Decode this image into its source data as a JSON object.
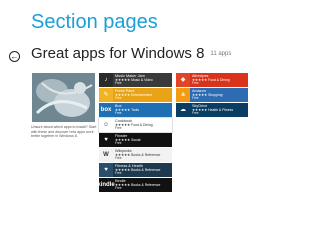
{
  "page_title": "Section pages",
  "collection": {
    "title": "Great apps for Windows 8",
    "count": "11 apps",
    "description": "Unsure about which apps to install? Start with these and discover how apps work better together in Windows 8."
  },
  "apps": [
    {
      "name": "Music Maker Jam",
      "rating": "★★★★★",
      "category": "Music & Video",
      "price": "Free",
      "bg": "#3a3a3a",
      "icon_bg": "#2b2b2b",
      "icon": "♪"
    },
    {
      "name": "Fresh Paint",
      "rating": "★★★★★",
      "category": "Entertainment",
      "price": "Free",
      "bg": "#e8a317",
      "icon_bg": "#f0b323",
      "icon": "✎"
    },
    {
      "name": "Box",
      "rating": "★★★★★",
      "category": "Tools",
      "price": "Free",
      "bg": "#1f6fb5",
      "icon_bg": "#1f6fb5",
      "icon": "box"
    },
    {
      "name": "Cookbook",
      "rating": "★★★★★",
      "category": "Food & Dining",
      "price": "Free",
      "bg": "#ffffff",
      "icon_bg": "#ffffff",
      "icon": "☺",
      "text_color": "#333",
      "border": "#e0e0e0"
    },
    {
      "name": "Flixster",
      "rating": "★★★★★",
      "category": "Social",
      "price": "Free",
      "bg": "#111111",
      "icon_bg": "#111111",
      "icon": "♥"
    },
    {
      "name": "Wikipedia",
      "rating": "★★★★★",
      "category": "Books & Reference",
      "price": "Free",
      "bg": "#f2f2f2",
      "icon_bg": "#f2f2f2",
      "icon": "W",
      "text_color": "#333"
    },
    {
      "name": "Fitness & Health",
      "rating": "★★★★★",
      "category": "Books & Reference",
      "price": "Free",
      "bg": "#1e3a4f",
      "icon_bg": "#2a4f6b",
      "icon": "♥"
    },
    {
      "name": "Kindle",
      "rating": "★★★★★",
      "category": "Books & Reference",
      "price": "Free",
      "bg": "#111111",
      "icon_bg": "#111111",
      "icon": "kindle"
    },
    {
      "name": "Allrecipes",
      "rating": "★★★★★",
      "category": "Food & Dining",
      "price": "Free",
      "bg": "#d9341b",
      "icon_bg": "#e24425",
      "icon": "◆"
    },
    {
      "name": "Amazon",
      "rating": "★★★★★",
      "category": "Shopping",
      "price": "Free",
      "bg": "#2d6bb3",
      "icon_bg": "#f39c12",
      "icon": "a"
    },
    {
      "name": "SkyDrive",
      "rating": "★★★★★",
      "category": "Health & Fitness",
      "price": "Free",
      "bg": "#0a3d62",
      "icon_bg": "#0a3d62",
      "icon": "☁"
    }
  ]
}
